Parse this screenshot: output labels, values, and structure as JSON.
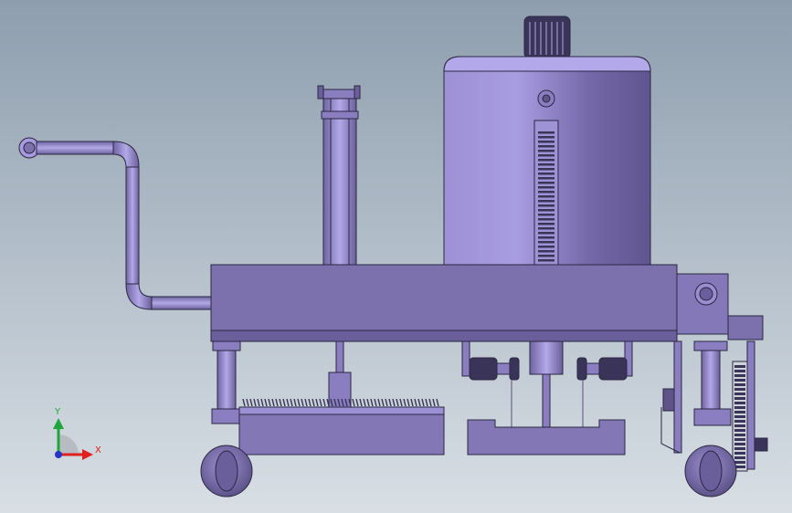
{
  "triad": {
    "y_label": "Y",
    "x_label": "X",
    "y_color": "#1ea63c",
    "x_color": "#e01f1f",
    "z_color": "#2436c8"
  },
  "palette": {
    "background_top": "#8f9fae",
    "background_bottom": "#d6dde3",
    "body": "#7b6faa",
    "body_light": "#a99ce0",
    "body_dark": "#5c5285",
    "outline": "#2b2742"
  }
}
